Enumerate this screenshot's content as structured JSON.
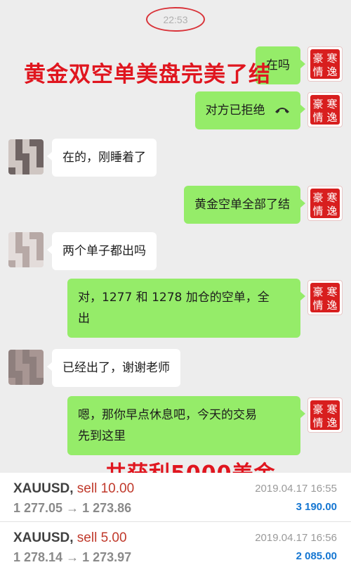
{
  "chat": {
    "timestamp": "22:53",
    "messages": [
      {
        "side": "me",
        "text": "在吗"
      },
      {
        "side": "me",
        "text": "对方已拒绝"
      },
      {
        "side": "other",
        "text": "在的，刚睡着了"
      },
      {
        "side": "me",
        "text": "黄金空单全部了结"
      },
      {
        "side": "other",
        "text": "两个单子都出吗"
      },
      {
        "side": "me",
        "line1": "对，1277 和 1278 加仓的空单，全",
        "line2": "出"
      },
      {
        "side": "other",
        "text": "已经出了，谢谢老师"
      },
      {
        "side": "me",
        "line1": "嗯，那你早点休息吧，今天的交易",
        "line2": "先到这里"
      }
    ],
    "stamp": {
      "c1": "寒",
      "c2": "逸",
      "c3": "豪",
      "c4": "情"
    }
  },
  "overlay": {
    "headline": "黄金双空单美盘完美了结",
    "profit": "共获利5000美金"
  },
  "trades": [
    {
      "symbol": "XAUUSD,",
      "action": "sell 10.00",
      "open": "1 277.05",
      "close": "1 273.86",
      "date": "2019.04.17 16:55",
      "profit": "3 190.00"
    },
    {
      "symbol": "XAUUSD,",
      "action": "sell 5.00",
      "open": "1 278.14",
      "close": "1 273.97",
      "date": "2019.04.17 16:56",
      "profit": "2 085.00"
    }
  ],
  "colors": {
    "bubble_me": "#95ec69",
    "overlay_red": "#e0161f",
    "profit_blue": "#1677d2",
    "sell_red": "#c0392b"
  }
}
